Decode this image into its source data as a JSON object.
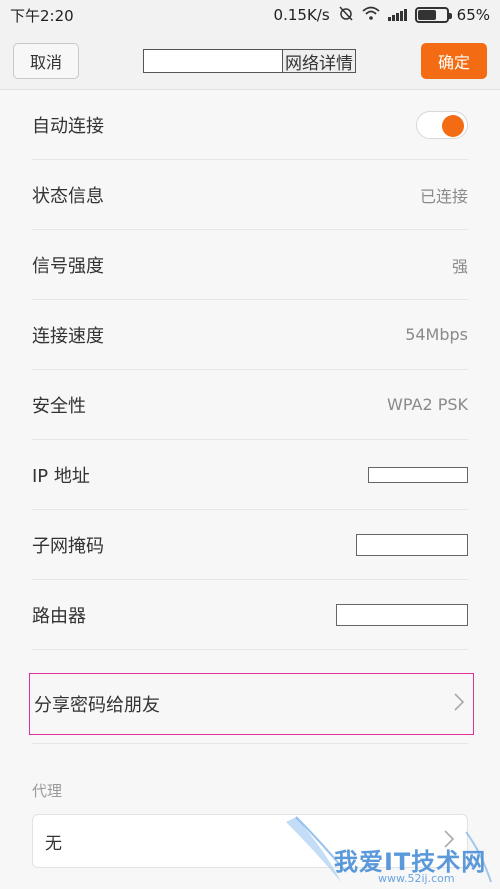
{
  "status_bar": {
    "time": "下午2:20",
    "speed": "0.15K/s",
    "battery_percent": "65%",
    "battery_level": 0.65
  },
  "header": {
    "cancel_label": "取消",
    "title": "网络详情",
    "ok_label": "确定"
  },
  "rows": [
    {
      "label": "自动连接",
      "toggle_on": true
    },
    {
      "label": "状态信息",
      "value": "已连接"
    },
    {
      "label": "信号强度",
      "value": "强"
    },
    {
      "label": "连接速度",
      "value": "54Mbps"
    },
    {
      "label": "安全性",
      "value": "WPA2 PSK"
    },
    {
      "label": "IP 地址",
      "value": ""
    },
    {
      "label": "子网掩码",
      "value": ""
    },
    {
      "label": "路由器",
      "value": ""
    }
  ],
  "share": {
    "label": "分享密码给朋友"
  },
  "proxy": {
    "section_label": "代理",
    "value": "无"
  },
  "watermark": {
    "text": "我爱IT技术网",
    "url": "www.52ij.com"
  },
  "colors": {
    "accent": "#f36b12",
    "highlight": "#e0309b"
  }
}
